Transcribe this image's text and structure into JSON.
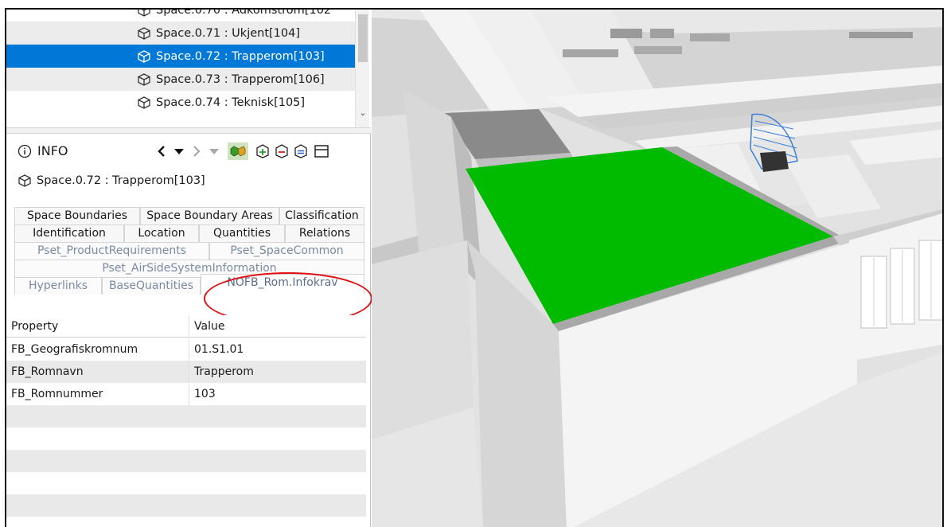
{
  "tree": {
    "items": [
      {
        "label": "Space.0.70 : Adkomstrom[102"
      },
      {
        "label": "Space.0.71 : Ukjent[104]"
      },
      {
        "label": "Space.0.72 : Trapperom[103]"
      },
      {
        "label": "Space.0.73 : Trapperom[106]"
      },
      {
        "label": "Space.0.74 : Teknisk[105]"
      }
    ],
    "selected_index": 2
  },
  "info": {
    "title": "INFO",
    "icons": [
      "info-icon",
      "back-arrow-icon",
      "dropdown-icon",
      "forward-arrow-icon",
      "dropdown-icon",
      "colored-cube-icon",
      "add-icon",
      "remove-icon",
      "equal-icon",
      "panel-icon"
    ]
  },
  "entity": {
    "label": "Space.0.72 : Trapperom[103]"
  },
  "tabs": {
    "row1": [
      "Space Boundaries",
      "Space Boundary Areas",
      "Classification"
    ],
    "row2": [
      "Identification",
      "Location",
      "Quantities",
      "Relations"
    ],
    "row3": [
      "Pset_ProductRequirements",
      "Pset_SpaceCommon"
    ],
    "row4": [
      "Pset_AirSideSystemInformation"
    ],
    "row5": [
      "Hyperlinks",
      "BaseQuantities",
      "NOFB_Rom.Infokrav"
    ],
    "active": "NOFB_Rom.Infokrav"
  },
  "table": {
    "headers": [
      "Property",
      "Value"
    ],
    "rows": [
      [
        "FB_Geografiskromnum",
        "01.S1.01"
      ],
      [
        "FB_Romnavn",
        "Trapperom"
      ],
      [
        "FB_Romnummer",
        "103"
      ]
    ]
  },
  "colors": {
    "selection": "#0078d7",
    "highlight_space": "#00bb00",
    "annotation_circle": "#e01010"
  }
}
